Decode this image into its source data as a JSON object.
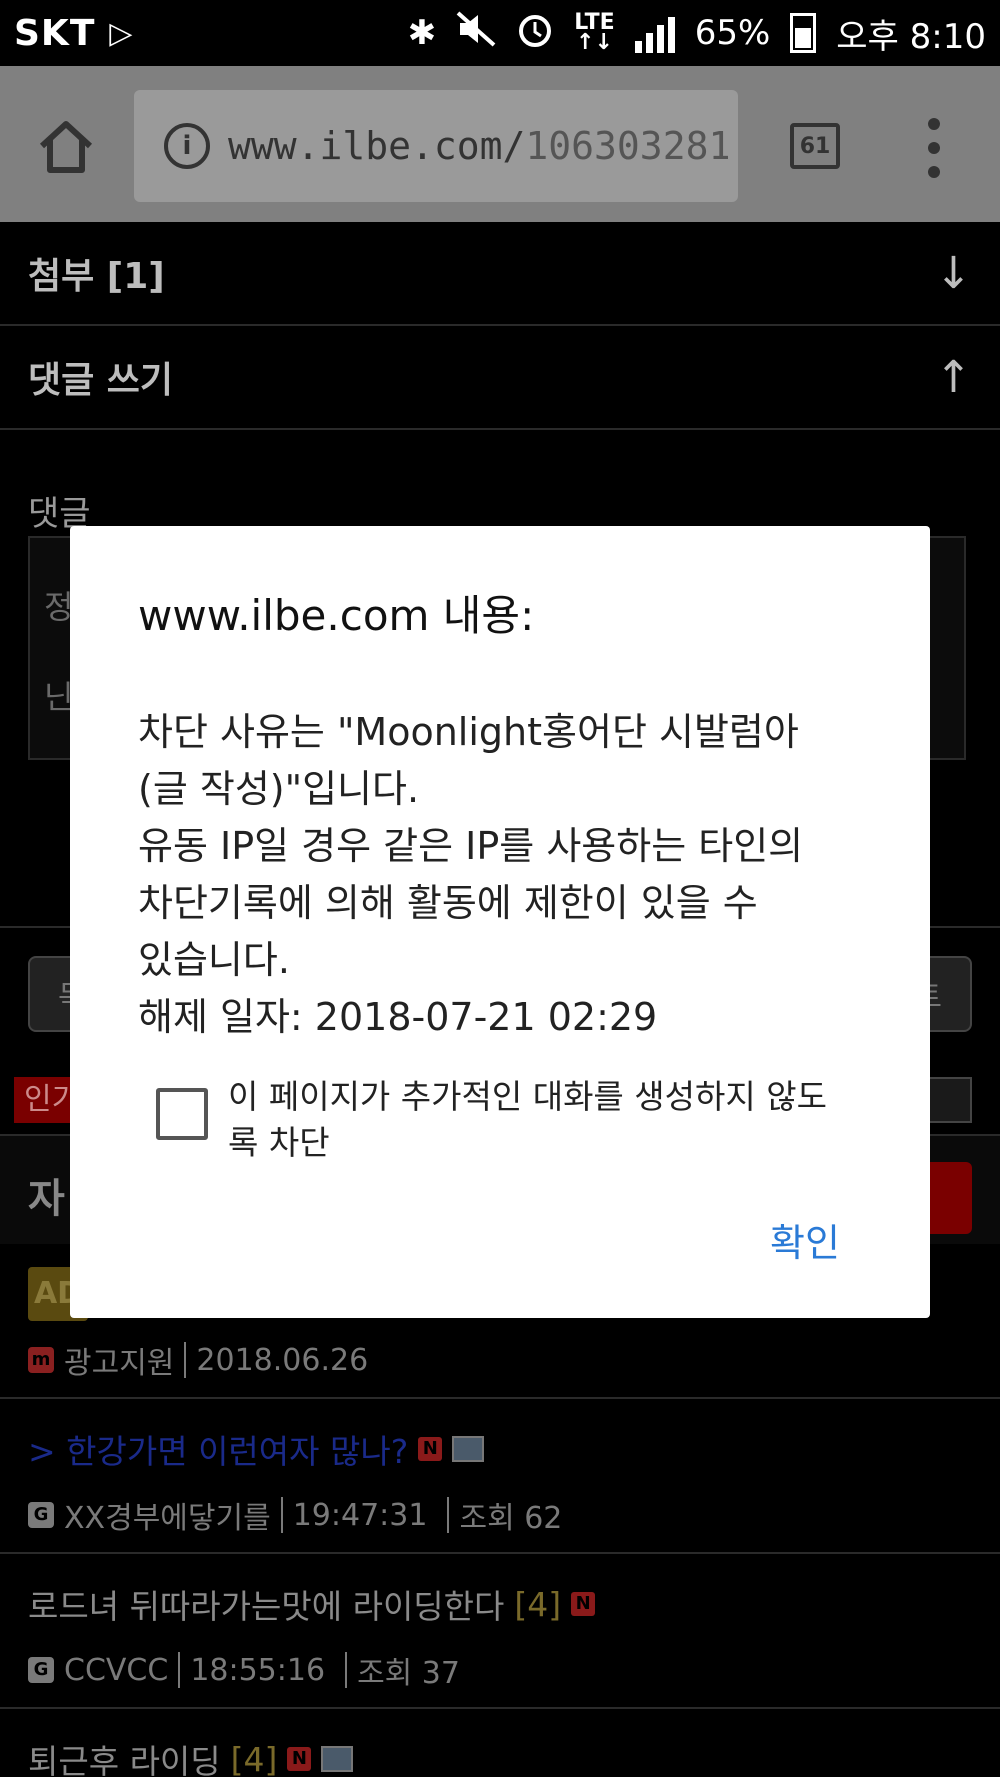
{
  "status_bar": {
    "carrier": "SKT",
    "network": "LTE",
    "battery": "65%",
    "time": "오후 8:10"
  },
  "browser": {
    "url_host": "www.ilbe.com/",
    "url_path": "106303281",
    "tab_count": "61"
  },
  "page": {
    "attachments_label": "첨부 [1]",
    "write_comment_label": "댓글 쓰기",
    "comment_label": "댓글",
    "comment_placeholder_line1": "정",
    "comment_placeholder_line2": "닌",
    "row_left_char": "목",
    "row_right_char": "트",
    "badge_text": "인기",
    "list_header": "자",
    "posts": [
      {
        "badge": "AD",
        "title": "",
        "author": "광고지원",
        "time": "2018.06.26",
        "views": ""
      },
      {
        "title": "> 한강가면 이런여자 많나?",
        "author": "XX경부에닿기를",
        "time": "19:47:31",
        "views": "조회 62"
      },
      {
        "title": "로드녀 뒤따라가는맛에 라이딩한다",
        "count": "[4]",
        "author": "CCVCC",
        "time": "18:55:16",
        "views": "조회 37"
      },
      {
        "title": "퇴근후 라이딩",
        "count": "[4]"
      }
    ]
  },
  "dialog": {
    "title": "www.ilbe.com 내용:",
    "message": "차단 사유는 \"Moonlight홍어단 시발럼아\n(글 작성)\"입니다.\n유동 IP일 경우 같은 IP를 사용하는 타인의\n차단기록에 의해 활동에 제한이 있을 수\n있습니다.\n해제 일자: 2018-07-21 02:29",
    "checkbox_label": "이 페이지가 추가적인 대화를 생성하지 않도록 차단",
    "checkbox_checked": false,
    "ok_label": "확인"
  }
}
